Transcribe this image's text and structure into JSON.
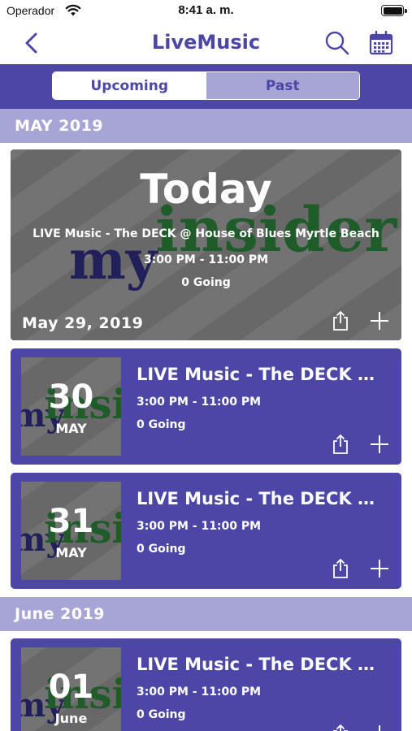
{
  "status_bar": {
    "carrier": "Operador",
    "time": "8:41 a. m."
  },
  "nav": {
    "title": "LiveMusic",
    "back_icon": "chevron-left-icon",
    "search_icon": "search-icon",
    "calendar_icon": "calendar-icon"
  },
  "tabs": [
    {
      "label": "Upcoming",
      "active": true
    },
    {
      "label": "Past",
      "active": false
    }
  ],
  "colors": {
    "brand": "#4c47a6",
    "section": "#a7a5d6",
    "card_image": "#6d6d6d"
  },
  "watermark": {
    "prefix": "my",
    "word": "insider"
  },
  "sections": [
    {
      "month": "MAY 2019",
      "featured": {
        "badge": "Today",
        "title": "LIVE Music - The DECK @ House of Blues Myrtle Beach",
        "time": "3:00 PM - 11:00 PM",
        "going": "0 Going",
        "date": "May 29, 2019"
      },
      "events": [
        {
          "day": "30",
          "month": "MAY",
          "title": "LIVE Music - The DECK @ House of Blues Myrtle Beach",
          "time": "3:00 PM - 11:00 PM",
          "going": "0 Going"
        },
        {
          "day": "31",
          "month": "MAY",
          "title": "LIVE Music - The DECK @ House of Blues Myrtle Beach",
          "time": "3:00 PM - 11:00 PM",
          "going": "0 Going"
        }
      ]
    },
    {
      "month": "June 2019",
      "events": [
        {
          "day": "01",
          "month": "June",
          "title": "LIVE Music - The DECK @ House of Blues Myrtle Beach",
          "time": "3:00 PM - 11:00 PM",
          "going": "0 Going"
        }
      ]
    }
  ]
}
